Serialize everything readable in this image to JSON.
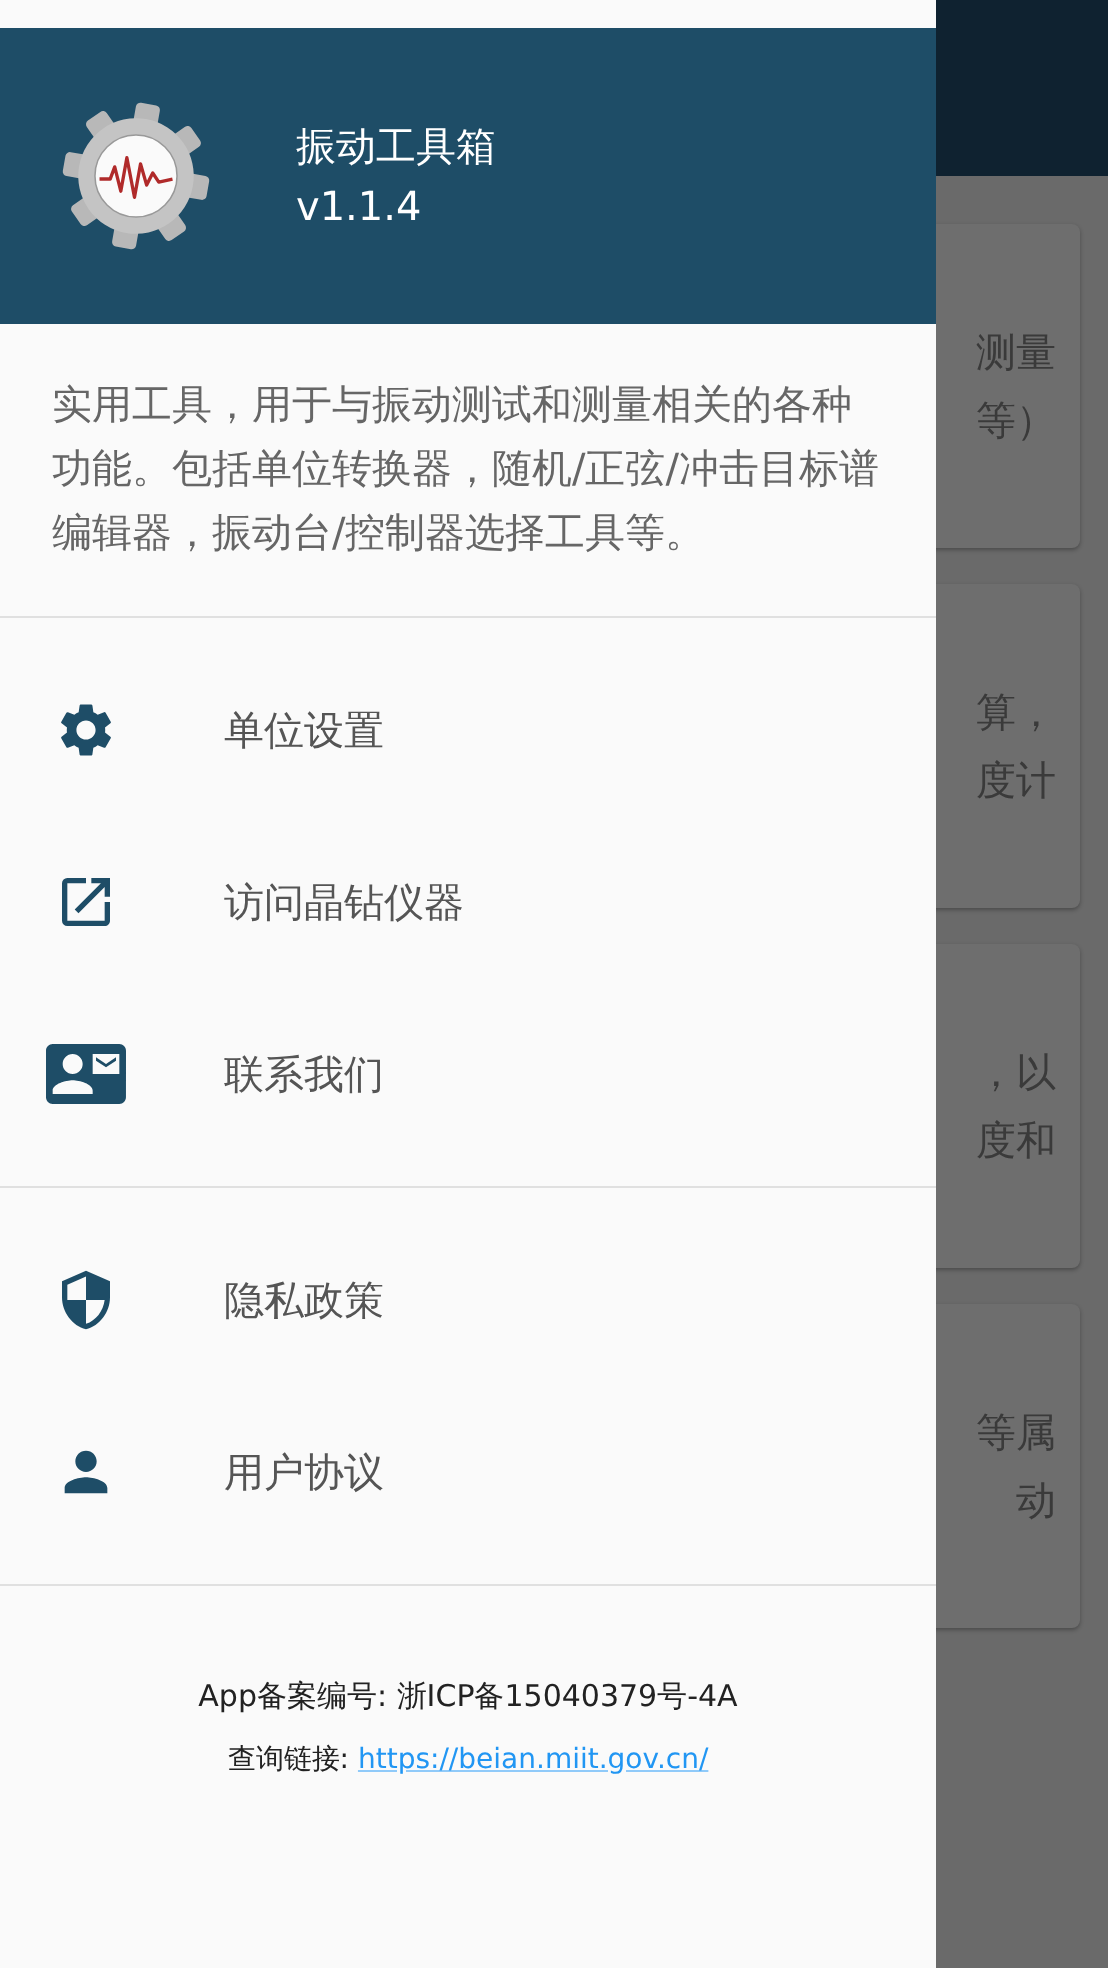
{
  "drawer": {
    "app_name": "振动工具箱",
    "version": "v1.1.4",
    "description": "实用工具，用于与振动测试和测量相关的各种功能。包括单位转换器，随机/正弦/冲击目标谱编辑器，振动台/控制器选择工具等。",
    "menu_groups": [
      [
        {
          "label": "单位设置"
        },
        {
          "label": "访问晶钻仪器"
        },
        {
          "label": "联系我们"
        }
      ],
      [
        {
          "label": "隐私政策"
        },
        {
          "label": "用户协议"
        }
      ]
    ],
    "footer": {
      "record": "App备案编号: 浙ICP备15040379号-4A",
      "link_label": "查询链接: ",
      "link": "https://beian.miit.gov.cn/"
    }
  },
  "background_cards": [
    {
      "lines": [
        "测量",
        "等）"
      ]
    },
    {
      "lines": [
        "算，",
        "度计"
      ]
    },
    {
      "lines": [
        "，以",
        "度和"
      ]
    },
    {
      "lines": [
        "等属",
        "动"
      ]
    }
  ]
}
